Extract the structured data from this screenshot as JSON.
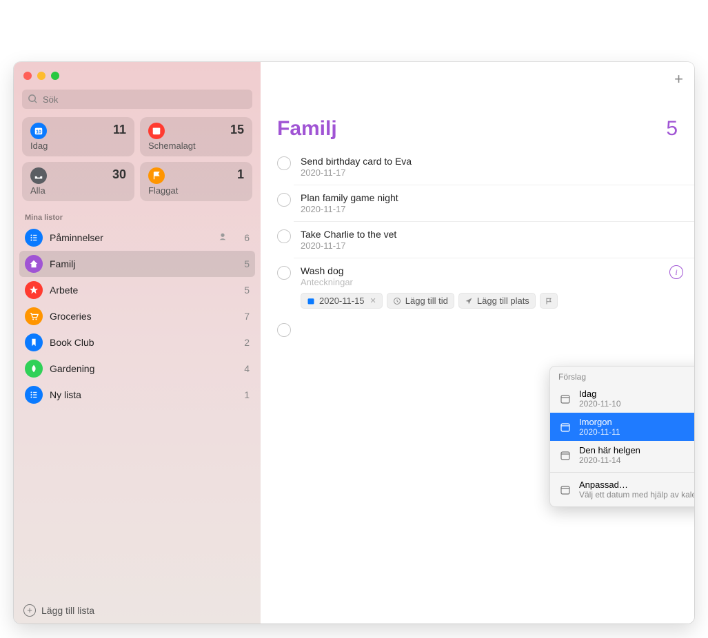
{
  "search": {
    "placeholder": "Sök"
  },
  "smart": [
    {
      "label": "Idag",
      "count": 11,
      "color": "#0a7aff",
      "icon": "calendar-today"
    },
    {
      "label": "Schemalagt",
      "count": 15,
      "color": "#ff3b30",
      "icon": "calendar"
    },
    {
      "label": "Alla",
      "count": 30,
      "color": "#5b5e63",
      "icon": "tray"
    },
    {
      "label": "Flaggat",
      "count": 1,
      "color": "#ff9500",
      "icon": "flag"
    }
  ],
  "section_label": "Mina listor",
  "lists": [
    {
      "name": "Påminnelser",
      "count": 6,
      "color": "#0a7aff",
      "icon": "list",
      "shared": true
    },
    {
      "name": "Familj",
      "count": 5,
      "color": "#a054d4",
      "icon": "home",
      "selected": true
    },
    {
      "name": "Arbete",
      "count": 5,
      "color": "#ff3b30",
      "icon": "star"
    },
    {
      "name": "Groceries",
      "count": 7,
      "color": "#ff9500",
      "icon": "cart"
    },
    {
      "name": "Book Club",
      "count": 2,
      "color": "#0a7aff",
      "icon": "bookmark"
    },
    {
      "name": "Gardening",
      "count": 4,
      "color": "#30d158",
      "icon": "leaf"
    },
    {
      "name": "Ny lista",
      "count": 1,
      "color": "#0a7aff",
      "icon": "list"
    }
  ],
  "footer": {
    "add_list": "Lägg till lista"
  },
  "main": {
    "title": "Familj",
    "total": 5,
    "reminders": [
      {
        "title": "Send birthday card to Eva",
        "date": "2020-11-17"
      },
      {
        "title": "Plan family game night",
        "date": "2020-11-17"
      },
      {
        "title": "Take Charlie to the vet",
        "date": "2020-11-17"
      },
      {
        "title": "Wash dog",
        "notes": "Anteckningar",
        "editing": true,
        "chips": {
          "date": "2020-11-15",
          "add_time": "Lägg till tid",
          "add_location": "Lägg till plats"
        }
      }
    ]
  },
  "popover": {
    "header": "Förslag",
    "items": [
      {
        "title": "Idag",
        "sub": "2020-11-10"
      },
      {
        "title": "Imorgon",
        "sub": "2020-11-11",
        "selected": true
      },
      {
        "title": "Den här helgen",
        "sub": "2020-11-14"
      }
    ],
    "custom": {
      "title": "Anpassad…",
      "sub": "Välj ett datum med hjälp av kalendern"
    }
  }
}
